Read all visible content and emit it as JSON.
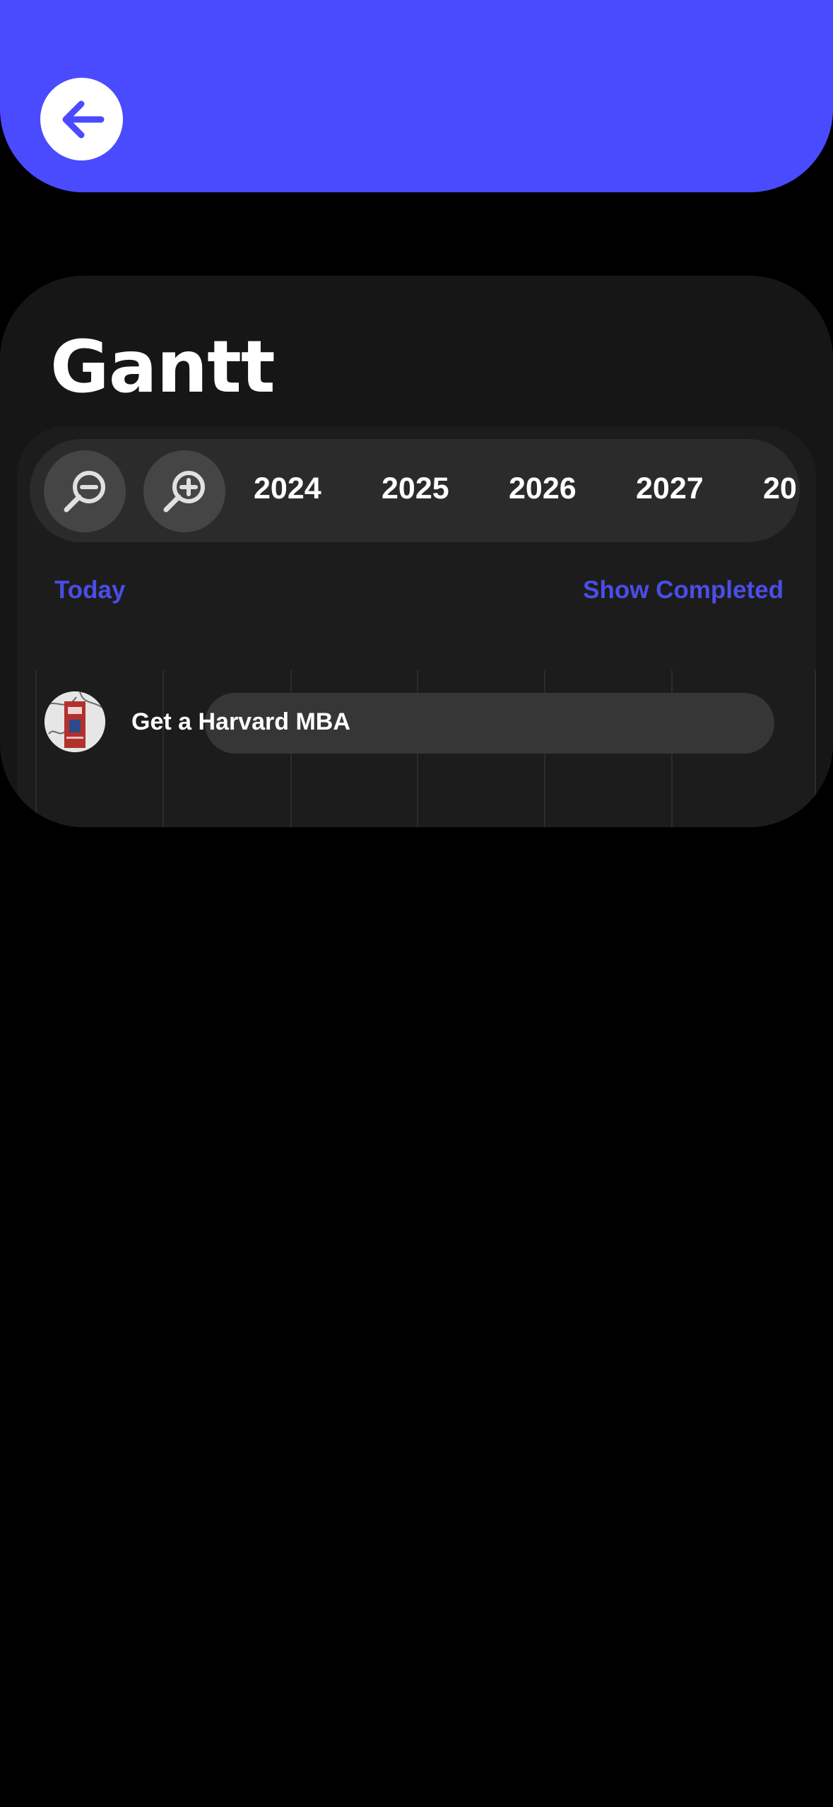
{
  "header": {
    "back_icon": "arrow-left-icon",
    "accent_color": "#4A4BFF"
  },
  "page": {
    "title": "Gantt"
  },
  "toolbar": {
    "zoom_out_icon": "zoom-out-icon",
    "zoom_in_icon": "zoom-in-icon",
    "years": [
      "2024",
      "2025",
      "2026",
      "2027",
      "20"
    ]
  },
  "links": {
    "today": "Today",
    "show_completed": "Show Completed",
    "link_color": "#4B4DE8"
  },
  "tasks": [
    {
      "label": "Get a Harvard MBA",
      "avatar_icon": "harvard-photo"
    }
  ]
}
